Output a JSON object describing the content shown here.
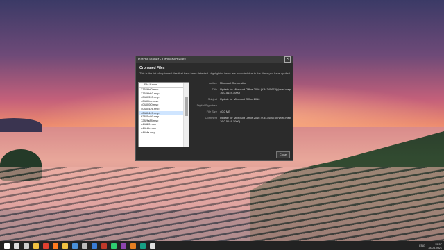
{
  "dialog": {
    "title": "PatchCleaner - Orphaned Files",
    "heading": "Orphaned Files",
    "description": "This is the list of orphaned files that have been detected. Highlighted items are excluded due to the filters you have applied.",
    "close_label": "Close",
    "file_list": {
      "header": "File Name",
      "items": [
        "27526bf0.msp",
        "27526bb3.msp",
        "40480393.msp",
        "40480fee.msp",
        "404800f0.msp",
        "40480426.msp",
        "40480447.msp",
        "62825c99.msp",
        "7282fa88.msp",
        "d44420.msp",
        "d44e8b.msp",
        "d44efa.msp"
      ],
      "selected_index": 6
    },
    "properties": [
      {
        "key": "Author",
        "value": "Microsoft Corporation"
      },
      {
        "key": "Title",
        "value": "Update for Microsoft Office 2016 (KB4345678) (word.msp 16.0.5149.1000)"
      },
      {
        "key": "Subject",
        "value": "Update for Microsoft Office 2016"
      },
      {
        "key": "Digital Signature",
        "value": ""
      },
      {
        "key": "File Size",
        "value": "40.0 MB"
      },
      {
        "key": "Comment",
        "value": "Update for Microsoft Office 2016 (KB4345678) (word.msp 16.0.5149.1000)"
      }
    ]
  },
  "taskbar": {
    "icons": [
      "windows-start-icon",
      "search-icon",
      "task-view-icon",
      "explorer-icon",
      "chrome-icon",
      "firefox-icon",
      "folder-icon",
      "store-icon",
      "settings-icon",
      "mail-icon",
      "app1-icon",
      "app2-icon",
      "app3-icon",
      "app4-icon",
      "app5-icon",
      "app6-icon"
    ],
    "lang": "ENG",
    "time": "15:57",
    "date": "18.05.2021"
  }
}
